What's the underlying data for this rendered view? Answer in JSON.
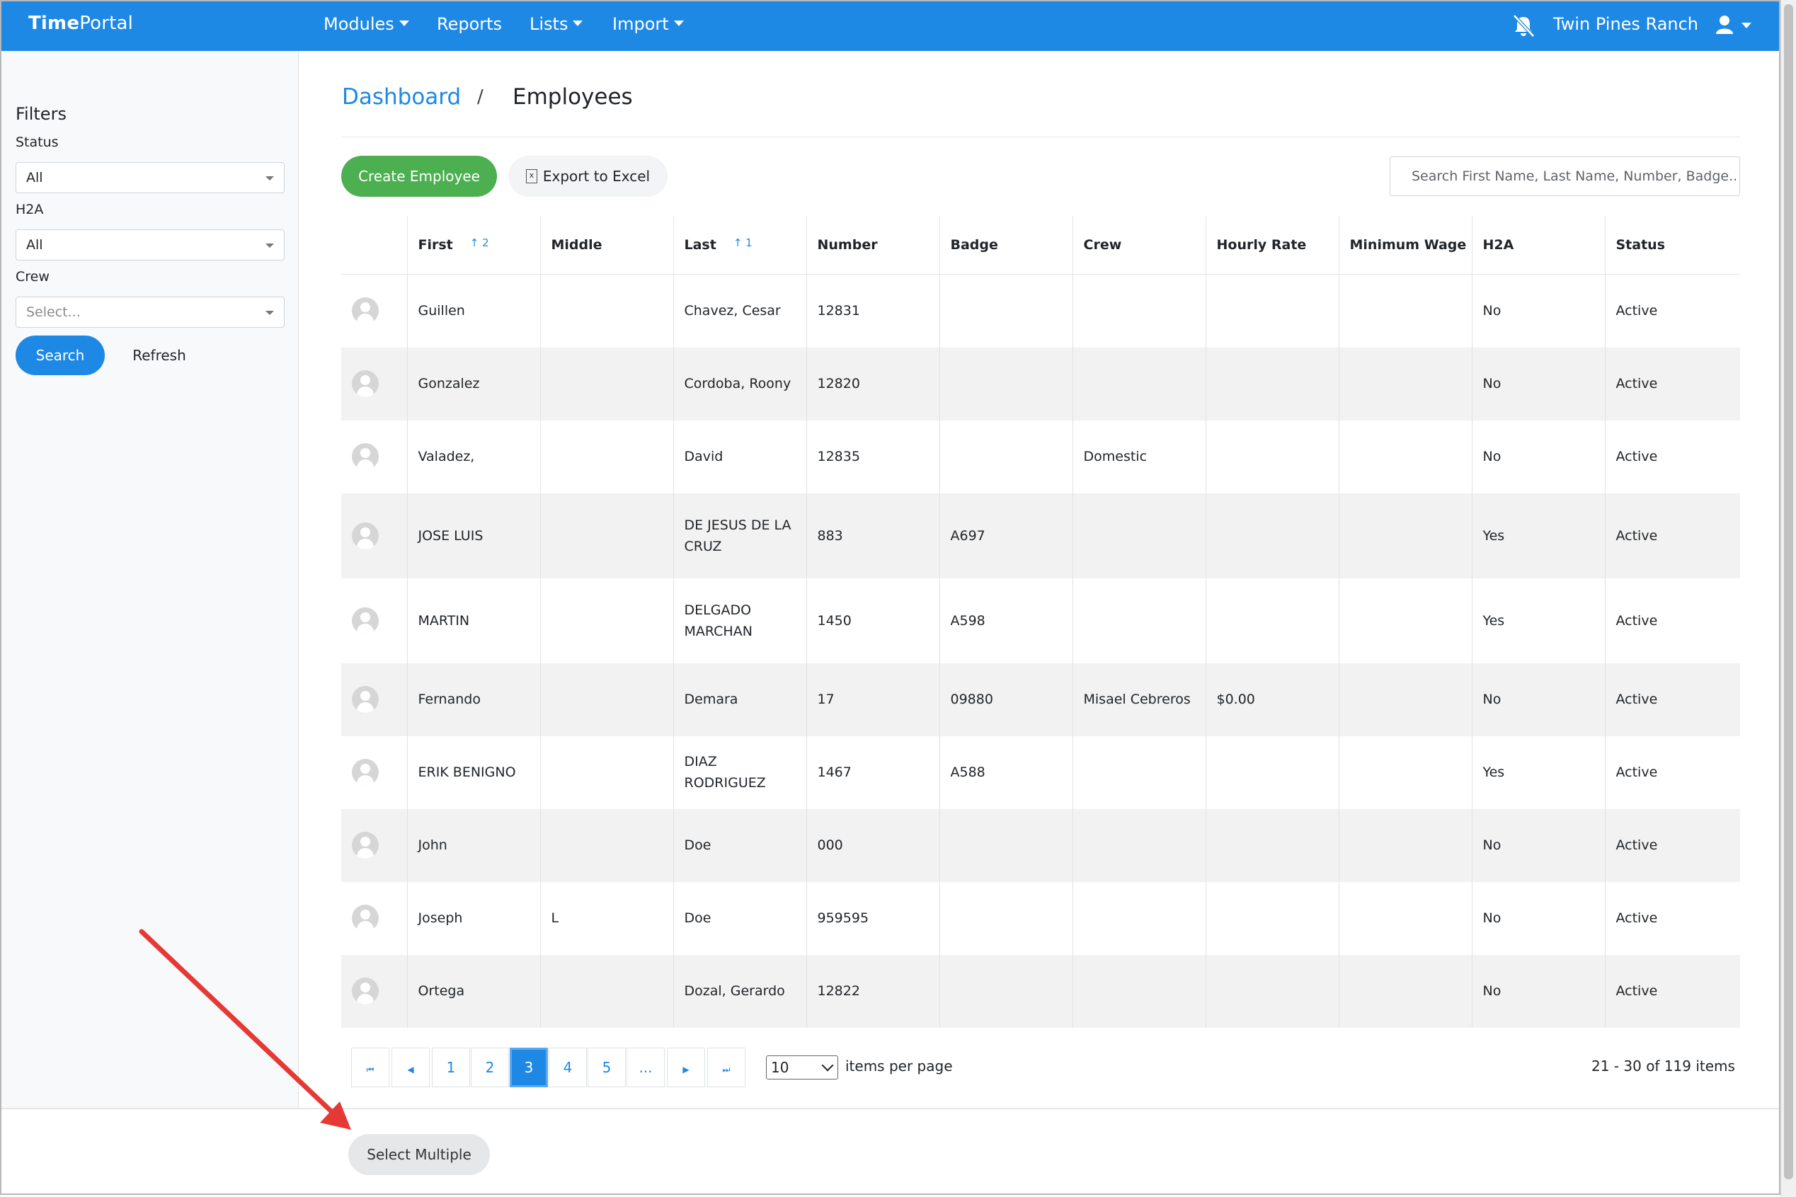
{
  "navbar": {
    "brand_bold": "Time",
    "brand_rest": "Portal",
    "menu": {
      "modules": "Modules",
      "reports": "Reports",
      "lists": "Lists",
      "import": "Import"
    },
    "notification_icon": "bell-slash-icon",
    "ranch_name": "Twin Pines Ranch",
    "user_icon": "user-icon"
  },
  "sidebar": {
    "title": "Filters",
    "status": {
      "label": "Status",
      "value": "All"
    },
    "h2a": {
      "label": "H2A",
      "value": "All"
    },
    "crew": {
      "label": "Crew",
      "placeholder": "Select..."
    },
    "search_label": "Search",
    "refresh_label": "Refresh"
  },
  "breadcrumb": {
    "parent": "Dashboard",
    "separator": "/",
    "current": "Employees"
  },
  "toolbar": {
    "create_label": "Create Employee",
    "export_label": "Export to Excel",
    "search_placeholder": "Search First Name, Last Name, Number, Badge.."
  },
  "table": {
    "columns": [
      "First",
      "Middle",
      "Last",
      "Number",
      "Badge",
      "Crew",
      "Hourly Rate",
      "Minimum Wage",
      "H2A",
      "Status"
    ],
    "sort": {
      "first": "↑ 2",
      "last": "↑ 1"
    },
    "rows": [
      {
        "first": "Guillen",
        "middle": "",
        "last": "Chavez, Cesar",
        "number": "12831",
        "badge": "",
        "crew": "",
        "hourly_rate": "",
        "minimum_wage": "",
        "h2a": "No",
        "status": "Active"
      },
      {
        "first": "Gonzalez",
        "middle": "",
        "last": "Cordoba, Roony",
        "number": "12820",
        "badge": "",
        "crew": "",
        "hourly_rate": "",
        "minimum_wage": "",
        "h2a": "No",
        "status": "Active"
      },
      {
        "first": "Valadez,",
        "middle": "",
        "last": "David",
        "number": "12835",
        "badge": "",
        "crew": "Domestic",
        "hourly_rate": "",
        "minimum_wage": "",
        "h2a": "No",
        "status": "Active"
      },
      {
        "first": "JOSE LUIS",
        "middle": "",
        "last": "DE JESUS DE LA CRUZ",
        "number": "883",
        "badge": "A697",
        "crew": "",
        "hourly_rate": "",
        "minimum_wage": "",
        "h2a": "Yes",
        "status": "Active"
      },
      {
        "first": "MARTIN",
        "middle": "",
        "last": "DELGADO MARCHAN",
        "number": "1450",
        "badge": "A598",
        "crew": "",
        "hourly_rate": "",
        "minimum_wage": "",
        "h2a": "Yes",
        "status": "Active"
      },
      {
        "first": "Fernando",
        "middle": "",
        "last": "Demara",
        "number": "17",
        "badge": "09880",
        "crew": "Misael Cebreros",
        "hourly_rate": "$0.00",
        "minimum_wage": "",
        "h2a": "No",
        "status": "Active"
      },
      {
        "first": "ERIK BENIGNO",
        "middle": "",
        "last": "DIAZ RODRIGUEZ",
        "number": "1467",
        "badge": "A588",
        "crew": "",
        "hourly_rate": "",
        "minimum_wage": "",
        "h2a": "Yes",
        "status": "Active"
      },
      {
        "first": "John",
        "middle": "",
        "last": "Doe",
        "number": "000",
        "badge": "",
        "crew": "",
        "hourly_rate": "",
        "minimum_wage": "",
        "h2a": "No",
        "status": "Active"
      },
      {
        "first": "Joseph",
        "middle": "L",
        "last": "Doe",
        "number": "959595",
        "badge": "",
        "crew": "",
        "hourly_rate": "",
        "minimum_wage": "",
        "h2a": "No",
        "status": "Active"
      },
      {
        "first": "Ortega",
        "middle": "",
        "last": "Dozal, Gerardo",
        "number": "12822",
        "badge": "",
        "crew": "",
        "hourly_rate": "",
        "minimum_wage": "",
        "h2a": "No",
        "status": "Active"
      }
    ]
  },
  "pagination": {
    "pages": [
      "1",
      "2",
      "3",
      "4",
      "5",
      "..."
    ],
    "current_page": "3",
    "items_per_page": "10",
    "items_per_page_label": "items per page",
    "info": "21 - 30 of 119 items"
  },
  "footer": {
    "select_multiple_label": "Select Multiple"
  },
  "colors": {
    "primary": "#1e88e5",
    "success": "#4caf50",
    "annotation_arrow": "#e53935"
  }
}
